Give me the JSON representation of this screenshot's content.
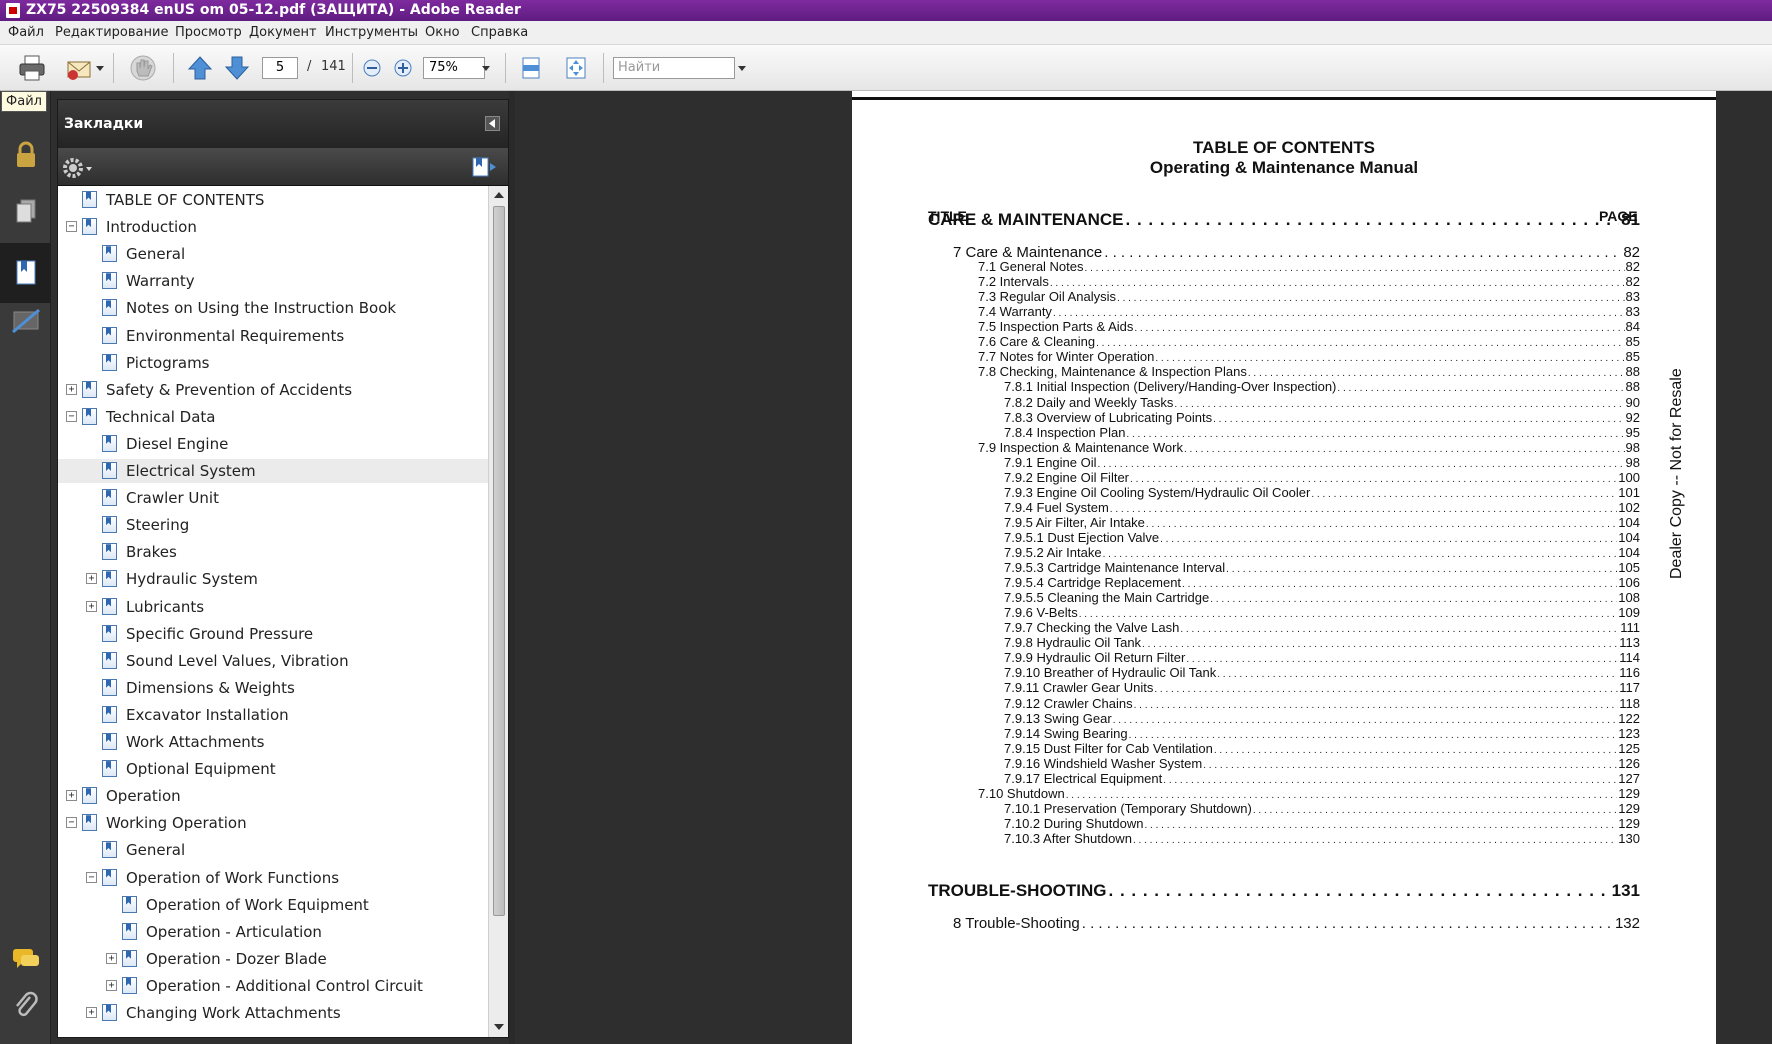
{
  "window": {
    "title": "ZX75 22509384 enUS om 05-12.pdf (ЗАЩИТА) - Adobe Reader"
  },
  "menu": [
    "Файл",
    "Редактирование",
    "Просмотр",
    "Документ",
    "Инструменты",
    "Окно",
    "Справка"
  ],
  "toolbar": {
    "current_page": "5",
    "page_sep": "/",
    "total_pages": "141",
    "zoom": "75%",
    "find_placeholder": "Найти"
  },
  "tooltip": "Файл",
  "bookmarks": {
    "title": "Закладки",
    "items": [
      {
        "label": "TABLE OF CONTENTS",
        "level": 0,
        "expander": ""
      },
      {
        "label": "Introduction",
        "level": 0,
        "expander": "−"
      },
      {
        "label": "General",
        "level": 1,
        "expander": ""
      },
      {
        "label": "Warranty",
        "level": 1,
        "expander": ""
      },
      {
        "label": "Notes on Using the Instruction Book",
        "level": 1,
        "expander": ""
      },
      {
        "label": "Environmental Requirements",
        "level": 1,
        "expander": ""
      },
      {
        "label": "Pictograms",
        "level": 1,
        "expander": ""
      },
      {
        "label": "Safety & Prevention of Accidents",
        "level": 0,
        "expander": "+"
      },
      {
        "label": "Technical Data",
        "level": 0,
        "expander": "−"
      },
      {
        "label": "Diesel Engine",
        "level": 1,
        "expander": ""
      },
      {
        "label": "Electrical System",
        "level": 1,
        "expander": "",
        "selected": true
      },
      {
        "label": "Crawler Unit",
        "level": 1,
        "expander": ""
      },
      {
        "label": "Steering",
        "level": 1,
        "expander": ""
      },
      {
        "label": "Brakes",
        "level": 1,
        "expander": ""
      },
      {
        "label": "Hydraulic System",
        "level": 1,
        "expander": "+"
      },
      {
        "label": "Lubricants",
        "level": 1,
        "expander": "+"
      },
      {
        "label": "Specific Ground Pressure",
        "level": 1,
        "expander": ""
      },
      {
        "label": "Sound Level Values, Vibration",
        "level": 1,
        "expander": ""
      },
      {
        "label": "Dimensions & Weights",
        "level": 1,
        "expander": ""
      },
      {
        "label": "Excavator Installation",
        "level": 1,
        "expander": ""
      },
      {
        "label": "Work Attachments",
        "level": 1,
        "expander": ""
      },
      {
        "label": "Optional Equipment",
        "level": 1,
        "expander": ""
      },
      {
        "label": "Operation",
        "level": 0,
        "expander": "+"
      },
      {
        "label": "Working Operation",
        "level": 0,
        "expander": "−"
      },
      {
        "label": "General",
        "level": 1,
        "expander": ""
      },
      {
        "label": "Operation of Work Functions",
        "level": 1,
        "expander": "−"
      },
      {
        "label": "Operation of Work Equipment",
        "level": 2,
        "expander": ""
      },
      {
        "label": "Operation - Articulation",
        "level": 2,
        "expander": ""
      },
      {
        "label": "Operation - Dozer Blade",
        "level": 2,
        "expander": "+"
      },
      {
        "label": "Operation - Additional Control Circuit",
        "level": 2,
        "expander": "+"
      },
      {
        "label": "Changing Work Attachments",
        "level": 1,
        "expander": "+"
      }
    ]
  },
  "document": {
    "title_line1": "TABLE OF CONTENTS",
    "title_line2": "Operating & Maintenance Manual",
    "col_title": "TITLE",
    "col_page": "PAGE",
    "side_text": "Dealer Copy -- Not for Resale",
    "toc": [
      {
        "text": "CARE & MAINTENANCE",
        "page": "81",
        "level": 0
      },
      {
        "text": "7 Care & Maintenance",
        "page": "82",
        "level": 1
      },
      {
        "text": "7.1 General Notes",
        "page": "82",
        "level": 2
      },
      {
        "text": "7.2 Intervals",
        "page": "82",
        "level": 2
      },
      {
        "text": "7.3 Regular Oil Analysis",
        "page": "83",
        "level": 2
      },
      {
        "text": "7.4 Warranty",
        "page": "83",
        "level": 2
      },
      {
        "text": "7.5 Inspection Parts & Aids",
        "page": "84",
        "level": 2
      },
      {
        "text": "7.6 Care & Cleaning",
        "page": "85",
        "level": 2
      },
      {
        "text": "7.7 Notes for Winter Operation",
        "page": "85",
        "level": 2
      },
      {
        "text": "7.8 Checking, Maintenance & Inspection Plans",
        "page": "88",
        "level": 2
      },
      {
        "text": "7.8.1 Initial Inspection (Delivery/Handing-Over Inspection)",
        "page": "88",
        "level": 3
      },
      {
        "text": "7.8.2 Daily and Weekly Tasks",
        "page": "90",
        "level": 3
      },
      {
        "text": "7.8.3 Overview of Lubricating Points",
        "page": "92",
        "level": 3
      },
      {
        "text": "7.8.4 Inspection Plan",
        "page": "95",
        "level": 3
      },
      {
        "text": "7.9 Inspection & Maintenance Work",
        "page": "98",
        "level": 2
      },
      {
        "text": "7.9.1 Engine Oil",
        "page": "98",
        "level": 3
      },
      {
        "text": "7.9.2 Engine Oil Filter",
        "page": "100",
        "level": 3
      },
      {
        "text": "7.9.3 Engine Oil Cooling System/Hydraulic Oil Cooler",
        "page": "101",
        "level": 3
      },
      {
        "text": "7.9.4 Fuel System",
        "page": "102",
        "level": 3
      },
      {
        "text": "7.9.5 Air Filter, Air Intake",
        "page": "104",
        "level": 3
      },
      {
        "text": "7.9.5.1 Dust Ejection Valve",
        "page": "104",
        "level": 3
      },
      {
        "text": "7.9.5.2 Air Intake",
        "page": "104",
        "level": 3
      },
      {
        "text": "7.9.5.3 Cartridge Maintenance Interval",
        "page": "105",
        "level": 3
      },
      {
        "text": "7.9.5.4 Cartridge Replacement",
        "page": "106",
        "level": 3
      },
      {
        "text": "7.9.5.5 Cleaning the Main Cartridge",
        "page": "108",
        "level": 3
      },
      {
        "text": "7.9.6 V-Belts",
        "page": "109",
        "level": 3
      },
      {
        "text": "7.9.7 Checking the Valve Lash",
        "page": "111",
        "level": 3
      },
      {
        "text": "7.9.8 Hydraulic Oil Tank",
        "page": "113",
        "level": 3
      },
      {
        "text": "7.9.9 Hydraulic Oil Return Filter",
        "page": "114",
        "level": 3
      },
      {
        "text": "7.9.10 Breather of Hydraulic Oil Tank",
        "page": "116",
        "level": 3
      },
      {
        "text": "7.9.11 Crawler Gear Units",
        "page": "117",
        "level": 3
      },
      {
        "text": "7.9.12 Crawler Chains",
        "page": "118",
        "level": 3
      },
      {
        "text": "7.9.13 Swing Gear",
        "page": "122",
        "level": 3
      },
      {
        "text": "7.9.14 Swing Bearing",
        "page": "123",
        "level": 3
      },
      {
        "text": "7.9.15 Dust Filter for Cab Ventilation",
        "page": "125",
        "level": 3
      },
      {
        "text": "7.9.16 Windshield Washer System",
        "page": "126",
        "level": 3
      },
      {
        "text": "7.9.17 Electrical Equipment",
        "page": "127",
        "level": 3
      },
      {
        "text": "7.10 Shutdown",
        "page": "129",
        "level": 2
      },
      {
        "text": "7.10.1 Preservation (Temporary Shutdown)",
        "page": "129",
        "level": 3
      },
      {
        "text": "7.10.2 During Shutdown",
        "page": "129",
        "level": 3
      },
      {
        "text": "7.10.3 After Shutdown",
        "page": "130",
        "level": 3
      },
      {
        "text": "TROUBLE-SHOOTING",
        "page": "131",
        "level": 0
      },
      {
        "text": "8 Trouble-Shooting",
        "page": "132",
        "level": 1
      }
    ]
  },
  "icons": {
    "toolbar": [
      "print-icon",
      "email-icon",
      "hand-icon",
      "prev-page-icon",
      "next-page-icon",
      "zoom-out-icon",
      "zoom-in-icon",
      "fit-page-icon",
      "fit-width-icon"
    ],
    "sidebar": [
      "lock-icon",
      "pages-icon",
      "bookmarks-icon",
      "signatures-icon",
      "comments-icon",
      "attachments-icon"
    ]
  },
  "colors": {
    "titlebar": "#6b2290",
    "accent": "#2f68b0"
  }
}
